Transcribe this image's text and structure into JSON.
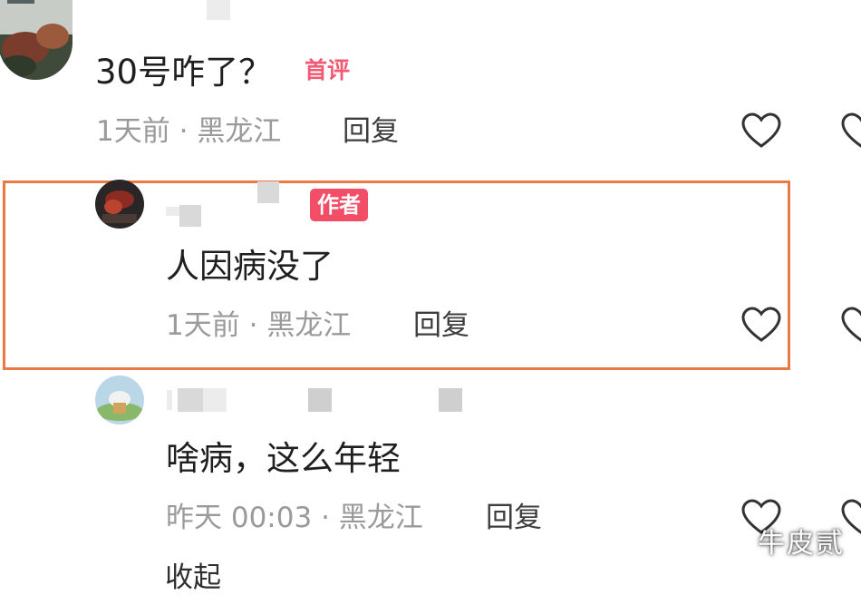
{
  "comments": [
    {
      "text": "30号咋了？",
      "badge": "首评",
      "time": "1天前",
      "separator": "·",
      "location": "黑龙江",
      "reply_label": "回复"
    },
    {
      "text": "人因病没了",
      "badge": "作者",
      "time": "1天前",
      "separator": "·",
      "location": "黑龙江",
      "reply_label": "回复"
    },
    {
      "text": "啥病，这么年轻",
      "time": "昨天 00:03",
      "separator": "·",
      "location": "黑龙江",
      "reply_label": "回复"
    }
  ],
  "footer": {
    "collapse_label": "收起"
  },
  "watermark": "牛皮贰",
  "icons": {
    "like": "heart-outline-icon",
    "side": "heart-outline-icon"
  },
  "colors": {
    "highlight_border": "#e87a46",
    "badge_red": "#f24e67",
    "first_comment_badge": "#f25a74",
    "meta_gray": "#9a9a9a"
  }
}
